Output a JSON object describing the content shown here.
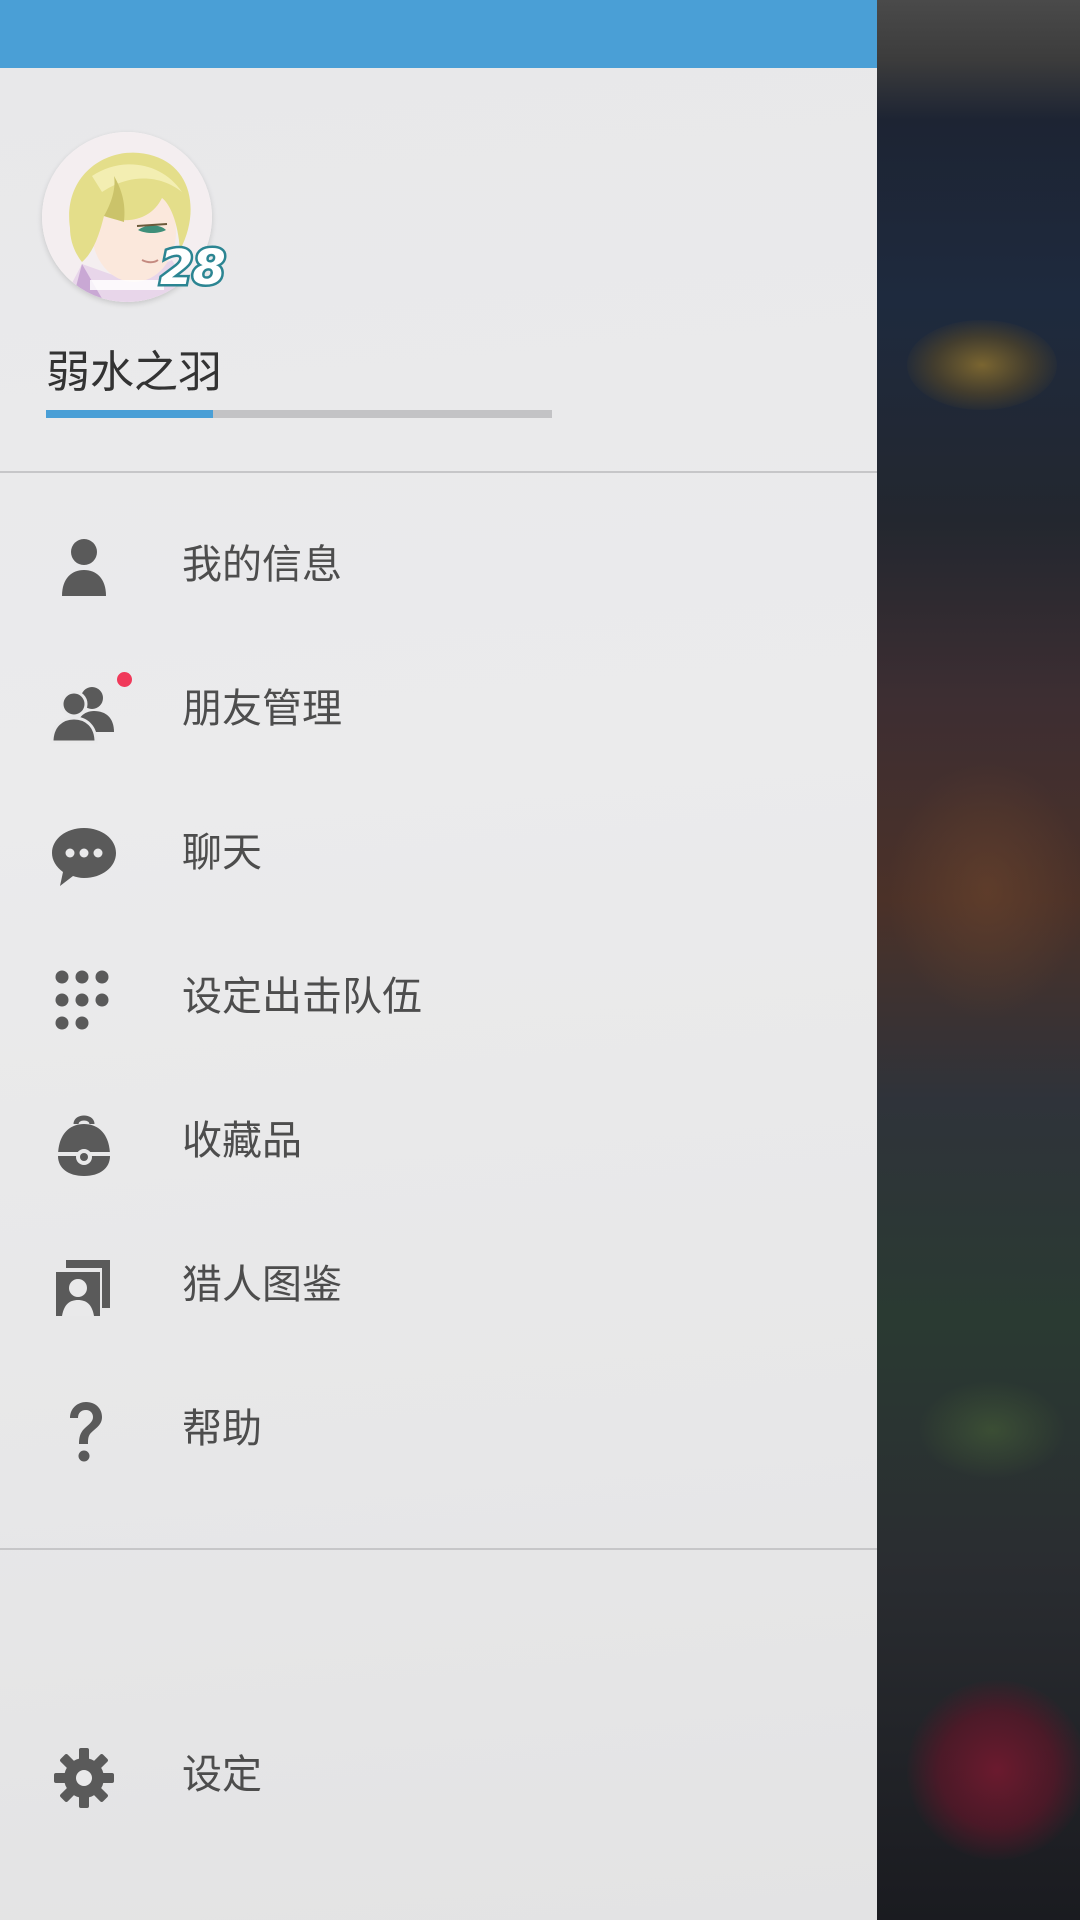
{
  "profile": {
    "username": "弱水之羽",
    "level": "28",
    "exp_progress": 0.33
  },
  "menu": [
    {
      "label": "我的信息",
      "icon": "person-icon"
    },
    {
      "label": "朋友管理",
      "icon": "friends-icon",
      "notification": true
    },
    {
      "label": "聊天",
      "icon": "chat-bubble-icon"
    },
    {
      "label": "设定出击队伍",
      "icon": "team-grid-icon"
    },
    {
      "label": "收藏品",
      "icon": "collection-bag-icon"
    },
    {
      "label": "猎人图鉴",
      "icon": "hunter-dex-icon"
    },
    {
      "label": "帮助",
      "icon": "help-question-icon"
    }
  ],
  "settings": {
    "label": "设定",
    "icon": "gear-icon"
  },
  "colors": {
    "accent": "#4a9fd6",
    "notification_dot": "#f0395a",
    "icon": "#5a5a5a",
    "label": "#4d4d4d"
  }
}
